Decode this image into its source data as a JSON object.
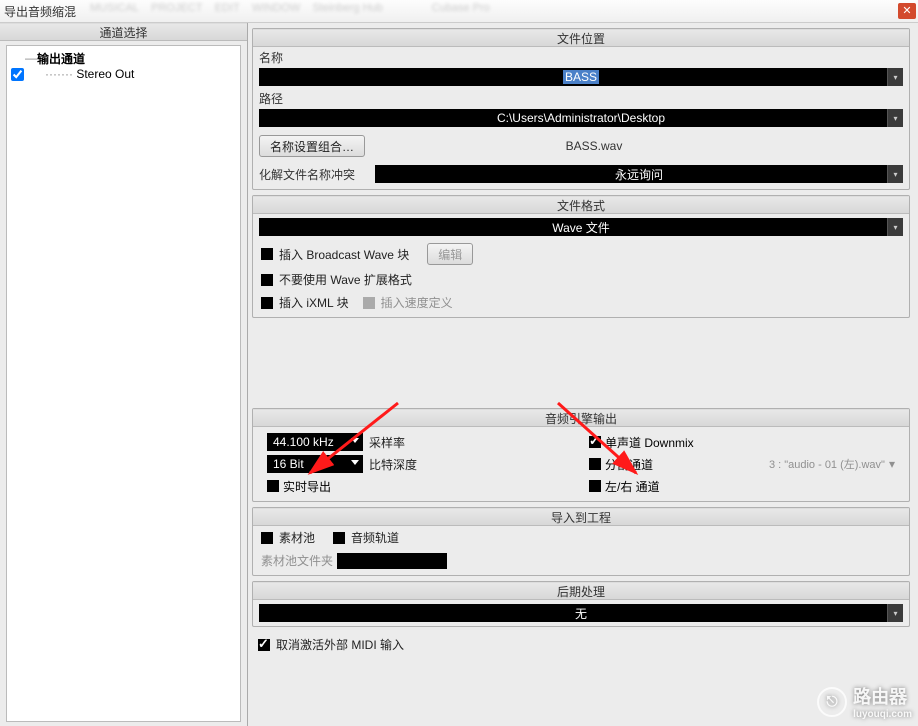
{
  "window": {
    "title": "导出音频缩混"
  },
  "left": {
    "heading": "通道选择",
    "output_channel_label": "输出通道",
    "stereo_out_label": "Stereo Out",
    "stereo_out_checked": true
  },
  "file_location": {
    "heading": "文件位置",
    "name_label": "名称",
    "name_value": "BASS",
    "path_label": "路径",
    "path_value": "C:\\Users\\Administrator\\Desktop",
    "name_combo_button": "名称设置组合…",
    "filename_display": "BASS.wav",
    "conflict_label": "化解文件名称冲突",
    "conflict_value": "永远询问"
  },
  "file_format": {
    "heading": "文件格式",
    "format_value": "Wave 文件",
    "insert_bwav_label": "插入 Broadcast Wave 块",
    "edit_button": "编辑",
    "no_wave_ext_label": "不要使用 Wave 扩展格式",
    "insert_ixml_label": "插入 iXML 块",
    "insert_tempo_label": "插入速度定义"
  },
  "engine": {
    "heading": "音频引擎输出",
    "sample_rate_value": "44.100 kHz",
    "sample_rate_label": "采样率",
    "bit_depth_value": "16 Bit",
    "bit_depth_label": "比特深度",
    "realtime_label": "实时导出",
    "mono_downmix_label": "单声道 Downmix",
    "split_channels_label": "分割通道",
    "split_filename": "3 : \"audio - 01 (左).wav\"",
    "lr_channels_label": "左/右 通道"
  },
  "import": {
    "heading": "导入到工程",
    "pool_label": "素材池",
    "audio_track_label": "音频轨道",
    "pool_folder_label": "素材池文件夹"
  },
  "post": {
    "heading": "后期处理",
    "value": "无"
  },
  "bottom": {
    "deactivate_midi_label": "取消激活外部 MIDI 输入"
  },
  "watermark": {
    "brand": "路由器",
    "url": "luyouqi.com"
  }
}
